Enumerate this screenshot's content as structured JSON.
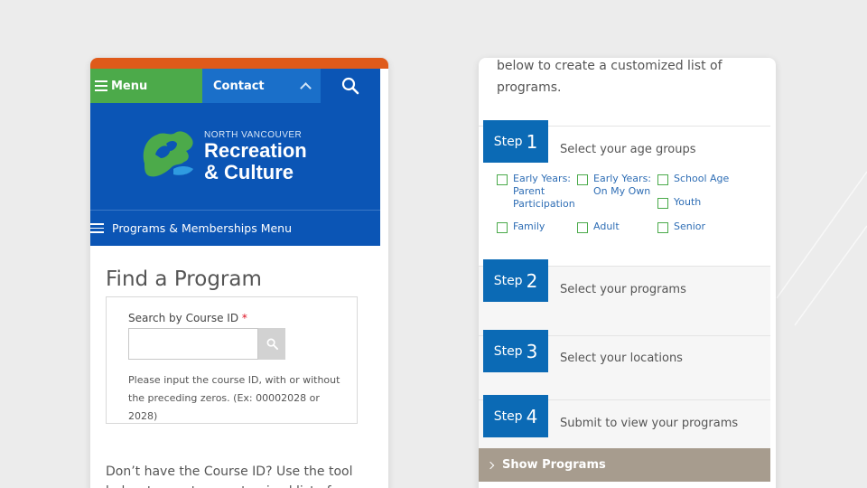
{
  "left": {
    "nav": {
      "menu_label": "Menu",
      "contact_label": "Contact"
    },
    "logo": {
      "line1": "NORTH VANCOUVER",
      "line2": "Recreation",
      "line3": "& Culture"
    },
    "programs_menu_label": "Programs & Memberships Menu",
    "find": {
      "title": "Find a Program",
      "search_label": "Search by Course ID",
      "required_mark": "*",
      "search_value": "",
      "help": "Please input the course ID, with or without the preceding zeros. (Ex: 00002028 or 2028)"
    },
    "no_course_text": "Don’t have the Course ID? Use the tool below to create a customized list of"
  },
  "right": {
    "intro": "below to create a customized list of programs.",
    "steps": [
      {
        "word": "Step",
        "num": "1",
        "title": "Select your age groups"
      },
      {
        "word": "Step",
        "num": "2",
        "title": "Select your programs"
      },
      {
        "word": "Step",
        "num": "3",
        "title": "Select your locations"
      },
      {
        "word": "Step",
        "num": "4",
        "title": "Submit to view your programs"
      }
    ],
    "age_groups": [
      "Early Years: Parent Participation",
      "Early Years: On My Own",
      "School Age",
      "Youth",
      "Family",
      "Adult",
      "Senior"
    ],
    "show_programs_label": "Show Programs"
  },
  "colors": {
    "orange": "#df5a1a",
    "green": "#4caa4a",
    "blue": "#0b55b5",
    "step_blue": "#0b6ab5",
    "button_tan": "#a79c8e"
  }
}
